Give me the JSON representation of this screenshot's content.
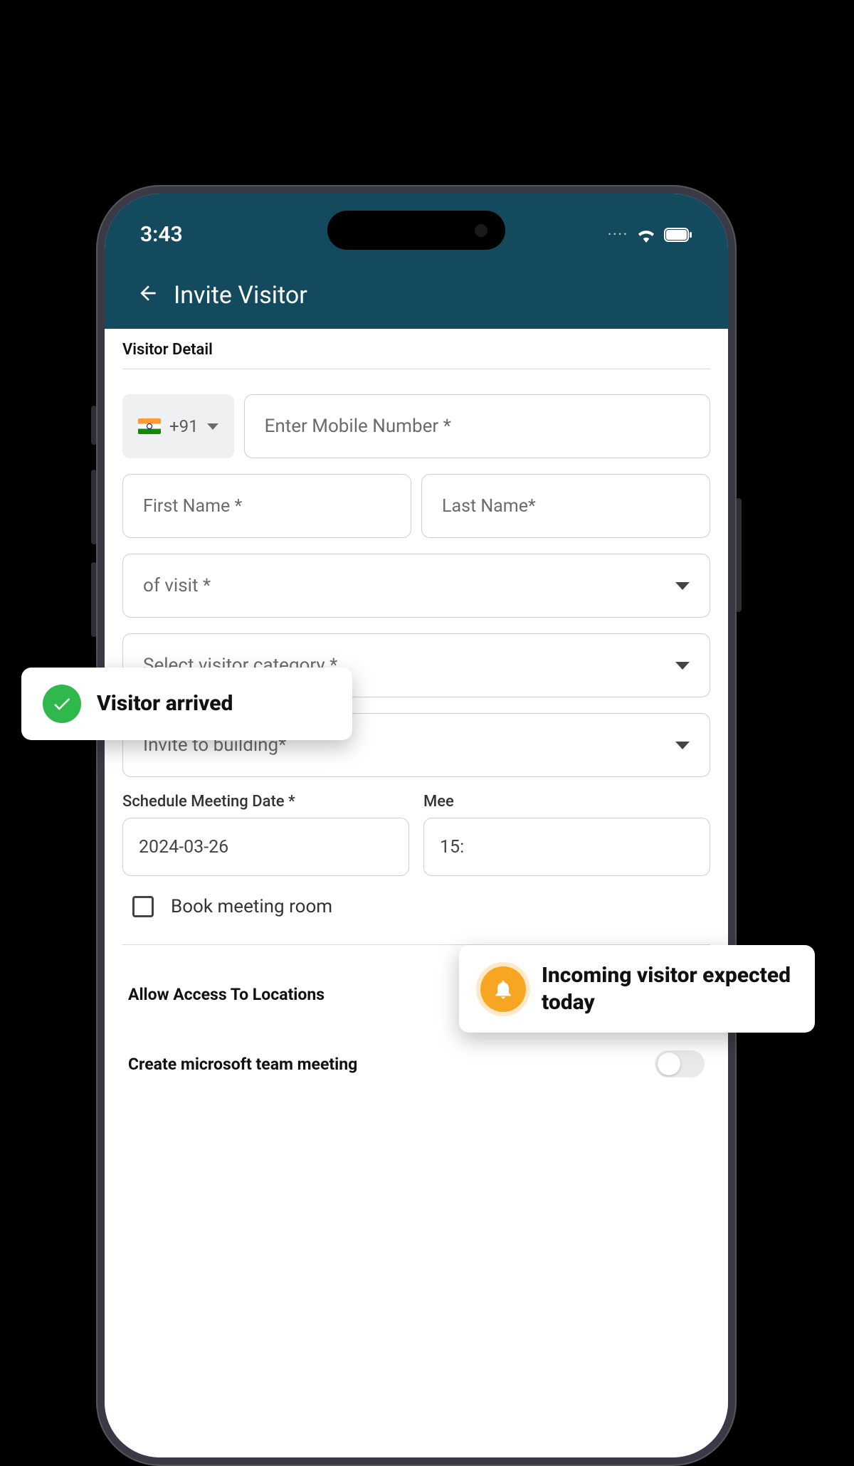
{
  "status": {
    "time": "3:43",
    "dots": "····"
  },
  "header": {
    "title": "Invite Visitor"
  },
  "section": {
    "title": "Visitor Detail"
  },
  "country": {
    "code": "+91"
  },
  "fields": {
    "mobile_placeholder": "Enter Mobile Number *",
    "first_name_placeholder": "First Name *",
    "last_name_placeholder": "Last Name*",
    "purpose_placeholder": "of visit *",
    "category_placeholder": "Select visitor category *",
    "building_placeholder": "Invite to building*"
  },
  "schedule": {
    "date_label": "Schedule Meeting Date *",
    "date_value": "2024-03-26",
    "time_label": "Mee",
    "time_value": "15:"
  },
  "checkbox": {
    "book_room": "Book meeting room"
  },
  "toggles": {
    "locations": "Allow Access To Locations",
    "teams": "Create microsoft team meeting"
  },
  "toasts": {
    "arrived": "Visitor arrived",
    "incoming": "Incoming visitor expected today"
  }
}
